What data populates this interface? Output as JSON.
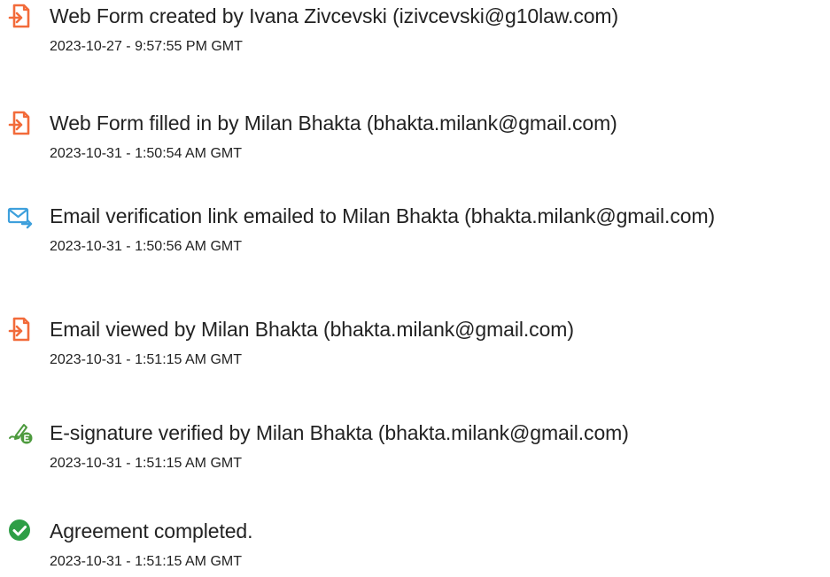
{
  "icon_colors": {
    "document": "#f26b3a",
    "email": "#3ea0dc",
    "esign": "#4c9a3d",
    "check": "#2e9e46"
  },
  "events": [
    {
      "icon": "document-icon",
      "title": "Web Form created by Ivana Zivcevski (izivcevski@g10law.com)",
      "timestamp": "2023-10-27 - 9:57:55 PM GMT"
    },
    {
      "icon": "document-icon",
      "title": "Web Form filled in by Milan Bhakta (bhakta.milank@gmail.com)",
      "timestamp": "2023-10-31 - 1:50:54 AM GMT"
    },
    {
      "icon": "email-send-icon",
      "title": "Email verification link emailed to Milan Bhakta (bhakta.milank@gmail.com)",
      "timestamp": "2023-10-31 - 1:50:56 AM GMT"
    },
    {
      "icon": "document-icon",
      "title": "Email viewed by Milan Bhakta (bhakta.milank@gmail.com)",
      "timestamp": "2023-10-31 - 1:51:15 AM GMT"
    },
    {
      "icon": "esignature-icon",
      "title": "E-signature verified by Milan Bhakta (bhakta.milank@gmail.com)",
      "timestamp": "2023-10-31 - 1:51:15 AM GMT"
    },
    {
      "icon": "checkmark-circle-icon",
      "title": "Agreement completed.",
      "timestamp": "2023-10-31 - 1:51:15 AM GMT"
    }
  ]
}
